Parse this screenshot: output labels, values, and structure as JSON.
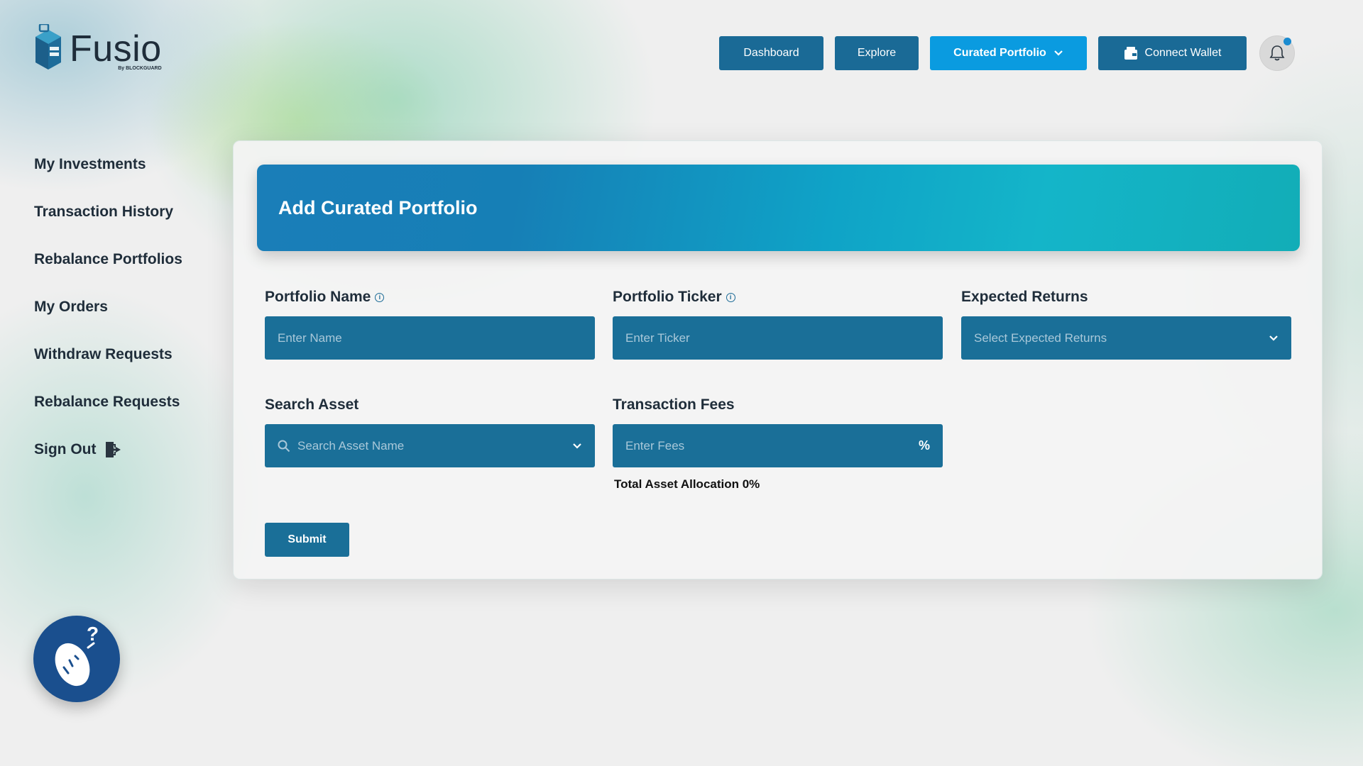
{
  "brand": {
    "name": "Fusio",
    "sub": "By BLOCKGUARD"
  },
  "nav": {
    "dashboard": "Dashboard",
    "explore": "Explore",
    "curated": "Curated Portfolio",
    "wallet": "Connect Wallet"
  },
  "sidebar": {
    "items": [
      {
        "label": "My Investments"
      },
      {
        "label": "Transaction History"
      },
      {
        "label": "Rebalance Portfolios"
      },
      {
        "label": "My Orders"
      },
      {
        "label": "Withdraw Requests"
      },
      {
        "label": "Rebalance Requests"
      },
      {
        "label": "Sign Out"
      }
    ]
  },
  "form": {
    "title": "Add Curated Portfolio",
    "portfolio_name": {
      "label": "Portfolio Name",
      "placeholder": "Enter Name"
    },
    "portfolio_ticker": {
      "label": "Portfolio Ticker",
      "placeholder": "Enter Ticker"
    },
    "expected_returns": {
      "label": "Expected Returns",
      "placeholder": "Select Expected Returns"
    },
    "search_asset": {
      "label": "Search Asset",
      "placeholder": "Search Asset Name"
    },
    "transaction_fees": {
      "label": "Transaction Fees",
      "placeholder": "Enter Fees",
      "unit": "%"
    },
    "allocation": "Total Asset Allocation 0%",
    "submit": "Submit"
  },
  "colors": {
    "primary": "#1a6f98",
    "accent": "#0a9be0",
    "text": "#1f2d3a"
  },
  "icons": [
    "logo-icon",
    "chevron-down-icon",
    "wallet-icon",
    "bell-icon",
    "info-icon",
    "search-icon",
    "sign-out-icon",
    "help-icon"
  ]
}
